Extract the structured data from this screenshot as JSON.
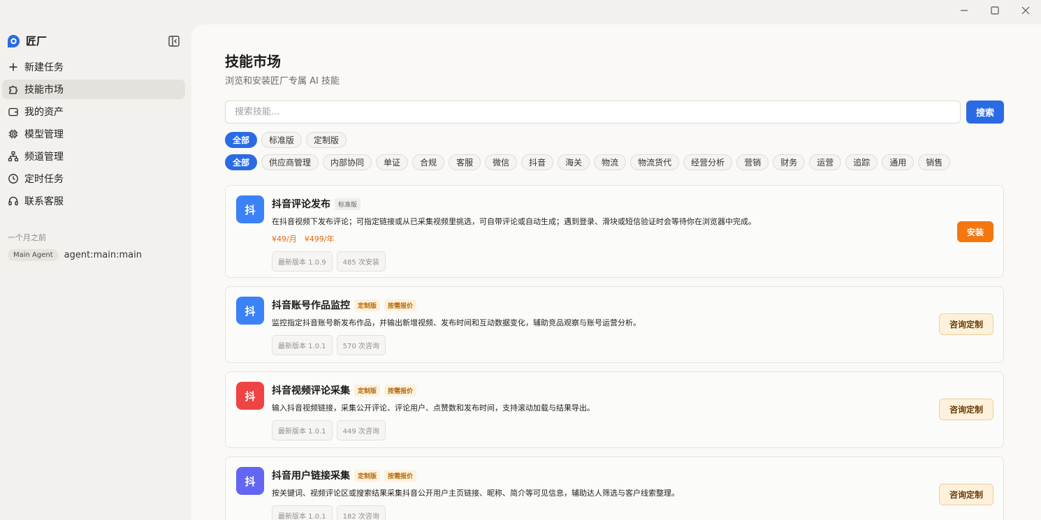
{
  "app": {
    "name": "匠厂"
  },
  "window": {
    "minimize": "minimize",
    "maximize": "maximize",
    "close": "close"
  },
  "sidebar": {
    "items": [
      {
        "label": "新建任务",
        "icon": "plus-icon"
      },
      {
        "label": "技能市场",
        "icon": "puzzle-icon",
        "active": true
      },
      {
        "label": "我的资产",
        "icon": "wallet-icon"
      },
      {
        "label": "模型管理",
        "icon": "chip-icon"
      },
      {
        "label": "频道管理",
        "icon": "network-icon"
      },
      {
        "label": "定时任务",
        "icon": "clock-icon"
      },
      {
        "label": "联系客服",
        "icon": "headset-icon"
      }
    ],
    "history_label": "一个月之前",
    "history": [
      {
        "tag": "Main Agent",
        "name": "agent:main:main"
      }
    ]
  },
  "page": {
    "title": "技能市场",
    "subtitle": "浏览和安装匠厂专属 AI 技能",
    "search_placeholder": "搜索技能...",
    "search_button": "搜索"
  },
  "filters": {
    "editions": [
      "全部",
      "标准版",
      "定制版"
    ],
    "categories": [
      "全部",
      "供应商管理",
      "内部协同",
      "单证",
      "合规",
      "客服",
      "微信",
      "抖音",
      "海关",
      "物流",
      "物流货代",
      "经营分析",
      "营销",
      "财务",
      "运营",
      "追踪",
      "通用",
      "销售"
    ]
  },
  "cards": [
    {
      "icon_text": "抖",
      "icon_color": "#3b82f6",
      "title": "抖音评论发布",
      "badges": [
        "标准版"
      ],
      "desc": "在抖音视频下发布评论；可指定链接或从已采集视频里挑选，可自带评论或自动生成；遇到登录、滑块或短信验证时会等待你在浏览器中完成。",
      "price_month": "¥49/月",
      "price_year": "¥499/年",
      "version": "最新版本 1.0.9",
      "count": "485 次安装",
      "action": "安装"
    },
    {
      "icon_text": "抖",
      "icon_color": "#3b82f6",
      "title": "抖音账号作品监控",
      "badges": [
        "定制版",
        "按需报价"
      ],
      "desc": "监控指定抖音账号新发布作品，并输出新增视频、发布时间和互动数据变化，辅助竞品观察与账号运营分析。",
      "version": "最新版本 1.0.1",
      "count": "570 次咨询",
      "action": "咨询定制"
    },
    {
      "icon_text": "抖",
      "icon_color": "#ef4444",
      "title": "抖音视频评论采集",
      "badges": [
        "定制版",
        "按需报价"
      ],
      "desc": "输入抖音视频链接，采集公开评论、评论用户、点赞数和发布时间，支持滚动加载与结果导出。",
      "version": "最新版本 1.0.1",
      "count": "449 次咨询",
      "action": "咨询定制"
    },
    {
      "icon_text": "抖",
      "icon_color": "#6366f1",
      "title": "抖音用户链接采集",
      "badges": [
        "定制版",
        "按需报价"
      ],
      "desc": "按关键词、视频评论区或搜索结果采集抖音公开用户主页链接、昵称、简介等可见信息，辅助达人筛选与客户线索整理。",
      "version": "最新版本 1.0.1",
      "count": "182 次咨询",
      "action": "咨询定制"
    }
  ]
}
